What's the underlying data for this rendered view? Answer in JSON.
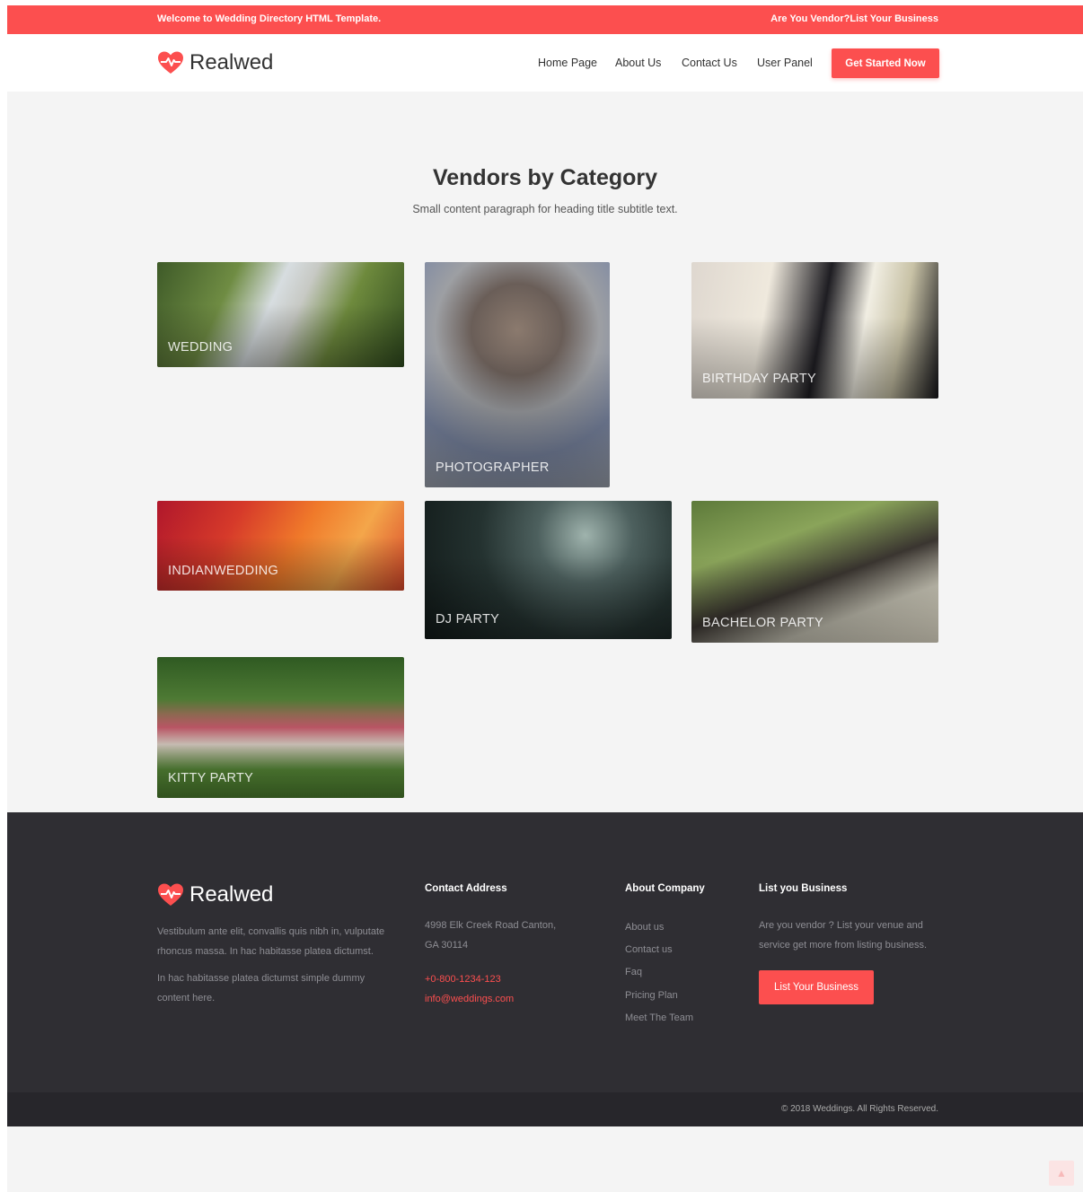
{
  "topbar": {
    "welcome": "Welcome to Wedding Directory HTML Template.",
    "vendor_link": "Are You Vendor?List Your Business"
  },
  "header": {
    "brand": "Realwed",
    "nav": [
      "Home Page",
      "About Us",
      "Contact Us",
      "User Panel"
    ],
    "cta": "Get Started Now"
  },
  "section": {
    "title": "Vendors by Category",
    "subtitle": "Small content paragraph for heading title subtitle text."
  },
  "categories": [
    {
      "label": "WEDDING",
      "image": "couple-kissing-in-palm-garden"
    },
    {
      "label": "PHOTOGRAPHER",
      "image": "man-holding-camera"
    },
    {
      "label": "BIRTHDAY PARTY",
      "image": "cutting-tiered-cake"
    },
    {
      "label": "INDIANWEDDING",
      "image": "indian-bride-hands-with-flowers"
    },
    {
      "label": "DJ PARTY",
      "image": "dj-with-headphones"
    },
    {
      "label": "BACHELOR PARTY",
      "image": "bridesmaids-walking-on-path"
    },
    {
      "label": "KITTY PARTY",
      "image": "bride-with-guests-on-lawn"
    }
  ],
  "footer": {
    "brand": "Realwed",
    "about_p1": "Vestibulum ante elit, convallis quis nibh in, vulputate rhoncus massa. In hac habitasse platea dictumst.",
    "about_p2": "In hac habitasse platea dictumst simple dummy content here.",
    "contact_heading": "Contact Address",
    "address": "4998 Elk Creek Road Canton, GA 30114",
    "phone": "+0-800-1234-123",
    "email": "info@weddings.com",
    "company_heading": "About Company",
    "company_links": [
      "About us",
      "Contact us",
      "Faq",
      "Pricing Plan",
      "Meet The Team"
    ],
    "list_heading": "List you Business",
    "list_text": "Are you vendor ? List your venue and service get more from listing business.",
    "list_button": "List Your Business",
    "copyright": "© 2018 Weddings. All Rights Reserved."
  },
  "colors": {
    "accent": "#fc4f4f",
    "footer_bg": "#2f2e33",
    "page_bg": "#f4f4f4"
  }
}
